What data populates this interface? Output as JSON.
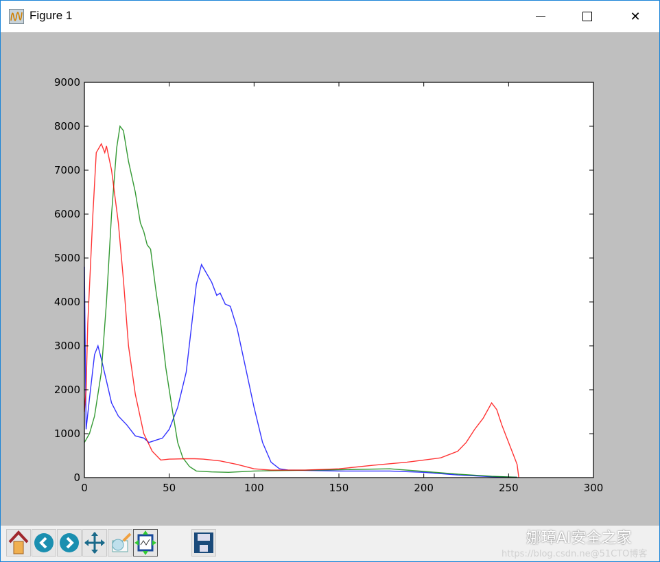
{
  "window": {
    "title": "Figure 1",
    "minimize_icon": "minimize-icon",
    "maximize_icon": "maximize-icon",
    "close_icon": "close-icon"
  },
  "toolbar": {
    "buttons": [
      "home-icon",
      "back-icon",
      "forward-icon",
      "pan-icon",
      "zoom-rect-icon",
      "subplots-icon",
      "save-icon"
    ]
  },
  "watermark": {
    "line1": "娜璋AI安全之家",
    "line2": "https://blog.csdn.ne@51CTO博客"
  },
  "chart_data": {
    "type": "line",
    "title": "",
    "xlabel": "",
    "ylabel": "",
    "xlim": [
      0,
      300
    ],
    "ylim": [
      0,
      9000
    ],
    "xticks": [
      0,
      50,
      100,
      150,
      200,
      250,
      300
    ],
    "yticks": [
      0,
      1000,
      2000,
      3000,
      4000,
      5000,
      6000,
      7000,
      8000,
      9000
    ],
    "grid": false,
    "series": [
      {
        "name": "blue",
        "color": "#0000ff",
        "x": [
          0,
          1,
          3,
          6,
          8,
          10,
          13,
          16,
          20,
          25,
          30,
          35,
          38,
          42,
          46,
          50,
          55,
          60,
          63,
          66,
          69,
          72,
          75,
          78,
          80,
          83,
          86,
          90,
          95,
          100,
          105,
          110,
          115,
          120,
          150,
          180,
          200,
          220,
          240,
          255
        ],
        "y": [
          4800,
          1100,
          1800,
          2800,
          3000,
          2700,
          2200,
          1700,
          1400,
          1200,
          950,
          900,
          800,
          850,
          900,
          1100,
          1600,
          2400,
          3400,
          4400,
          4850,
          4650,
          4450,
          4150,
          4200,
          3950,
          3900,
          3400,
          2500,
          1600,
          800,
          350,
          200,
          170,
          150,
          150,
          120,
          60,
          20,
          10
        ]
      },
      {
        "name": "green",
        "color": "#008000",
        "x": [
          0,
          3,
          6,
          10,
          13,
          16,
          19,
          21,
          23,
          26,
          30,
          33,
          35,
          37,
          39,
          42,
          45,
          48,
          52,
          55,
          58,
          62,
          66,
          75,
          85,
          100,
          150,
          180,
          200,
          220,
          240,
          255
        ],
        "y": [
          800,
          1000,
          1400,
          2400,
          4000,
          6000,
          7500,
          8000,
          7900,
          7200,
          6500,
          5800,
          5600,
          5300,
          5200,
          4300,
          3500,
          2500,
          1500,
          800,
          450,
          250,
          150,
          130,
          120,
          150,
          180,
          200,
          140,
          80,
          30,
          10
        ]
      },
      {
        "name": "red",
        "color": "#ff0000",
        "x": [
          0,
          1,
          2,
          5,
          7,
          10,
          12,
          13,
          16,
          20,
          23,
          26,
          30,
          35,
          40,
          45,
          50,
          60,
          65,
          70,
          80,
          90,
          100,
          110,
          130,
          150,
          170,
          190,
          200,
          210,
          220,
          225,
          230,
          235,
          240,
          243,
          246,
          250,
          253,
          255,
          256
        ],
        "y": [
          1500,
          2000,
          3500,
          6000,
          7400,
          7600,
          7400,
          7550,
          7000,
          5800,
          4500,
          3000,
          1900,
          1000,
          600,
          400,
          420,
          430,
          430,
          420,
          380,
          300,
          200,
          170,
          170,
          200,
          280,
          350,
          400,
          450,
          600,
          800,
          1100,
          1350,
          1700,
          1550,
          1200,
          800,
          500,
          300,
          0
        ]
      }
    ]
  }
}
